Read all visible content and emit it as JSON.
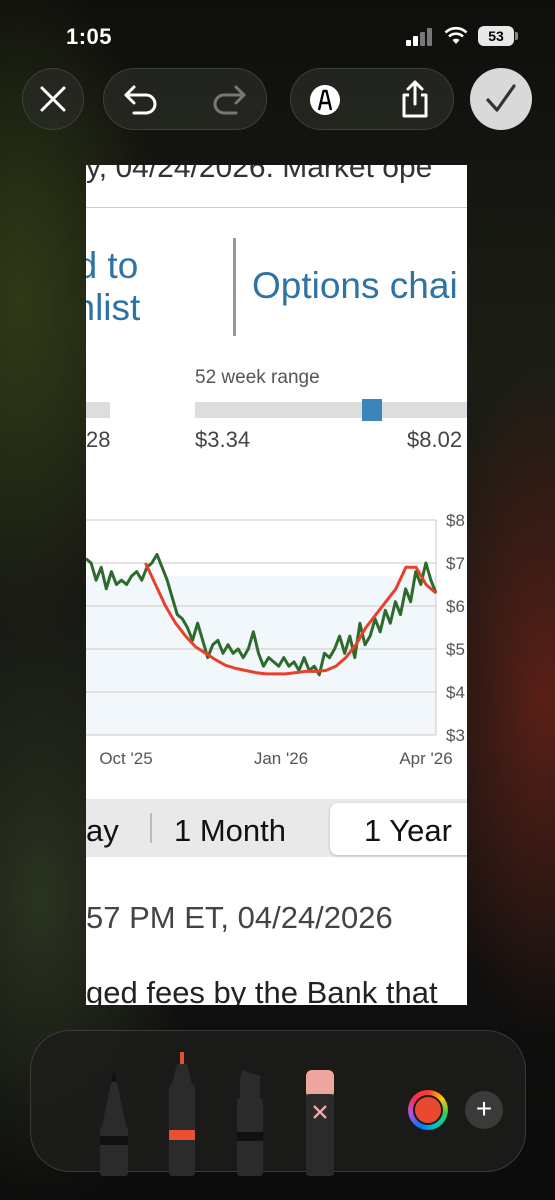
{
  "status_bar": {
    "time": "1:05",
    "battery": "53"
  },
  "toolbar": {
    "close": "close-icon",
    "undo": "undo-icon",
    "redo": "redo-icon",
    "markup": "markup-pen-icon",
    "share": "share-icon",
    "done": "checkmark-icon"
  },
  "screenshot": {
    "top_text": "y, 04/24/2026. Market ope",
    "add_watchlist_line1": "dd to",
    "add_watchlist_line2": "chlist",
    "options_chain": "Options chai",
    "week_range_label": "52 week range",
    "range_left_fragment": "28",
    "range_low": "$3.34",
    "range_high": "$8.02",
    "range_position": 0.65,
    "period_tabs": [
      "ay",
      "1 Month",
      "1 Year"
    ],
    "selected_tab": "1 Year",
    "timestamp": "57 PM ET, 04/24/2026",
    "body_fragment": "ged fees by the Bank that"
  },
  "chart_data": {
    "type": "line",
    "x_ticks": [
      "Oct '25",
      "Jan '26",
      "Apr '26"
    ],
    "y_ticks": [
      "$8",
      "$7",
      "$6",
      "$5",
      "$4",
      "$3"
    ],
    "ylim": [
      3,
      8
    ],
    "series": [
      {
        "color": "#2e6b2a",
        "values": [
          7.1,
          7.0,
          6.6,
          6.9,
          6.4,
          6.8,
          6.5,
          6.6,
          6.5,
          6.7,
          6.8,
          6.6,
          6.9,
          7.0,
          7.2,
          6.9,
          6.6,
          6.2,
          5.8,
          5.7,
          5.5,
          5.2,
          5.6,
          5.2,
          4.8,
          5.1,
          5.2,
          4.9,
          5.1,
          4.9,
          5.0,
          4.8,
          5.0,
          5.4,
          4.9,
          4.6,
          4.8,
          4.7,
          4.6,
          4.8,
          4.6,
          4.7,
          4.5,
          4.8,
          4.5,
          4.6,
          4.4,
          4.9,
          4.8,
          5.0,
          5.3,
          4.9,
          5.3,
          4.8,
          5.6,
          5.1,
          5.3,
          5.7,
          5.4,
          5.9,
          5.6,
          6.1,
          5.8,
          6.4,
          6.1,
          6.8,
          6.5,
          7.0,
          6.6,
          6.3
        ],
        "x_start": 0,
        "x_end": 1
      },
      {
        "color": "#e8402a",
        "values": [
          7.0,
          6.5,
          6.0,
          5.6,
          5.3,
          5.05,
          4.9,
          4.75,
          4.62,
          4.55,
          4.5,
          4.45,
          4.42,
          4.42,
          4.42,
          4.45,
          4.48,
          4.48,
          4.5,
          4.6,
          4.8,
          5.1,
          5.5,
          5.8,
          6.1,
          6.4,
          6.9,
          6.9,
          6.5,
          6.3
        ],
        "x_start": 0.17,
        "x_end": 1
      }
    ]
  }
}
